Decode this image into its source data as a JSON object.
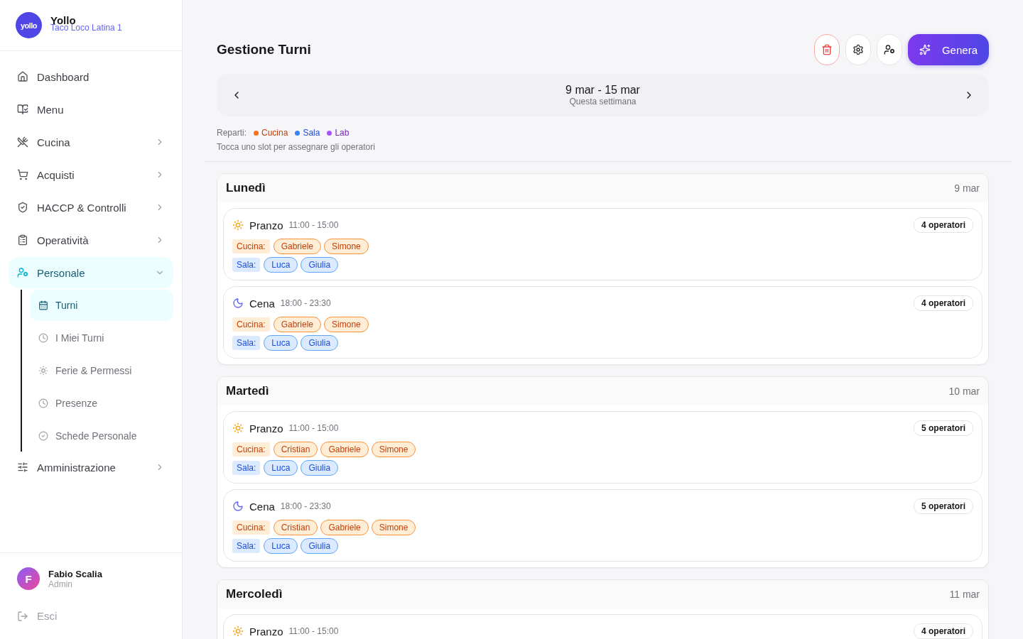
{
  "brand": {
    "logo": "yollo",
    "name": "Yollo",
    "location": "Taco Loco Latina 1"
  },
  "nav": [
    {
      "label": "Dashboard",
      "selected": false
    },
    {
      "label": "Menu",
      "selected": false
    },
    {
      "label": "Cucina",
      "selected": false,
      "expanded": false
    },
    {
      "label": "Acquisti",
      "selected": false,
      "expanded": false
    },
    {
      "label": "HACCP & Controlli",
      "selected": false,
      "expanded": false
    },
    {
      "label": "Operatività",
      "selected": false,
      "expanded": false
    },
    {
      "label": "Personale",
      "selected": true,
      "expanded": true,
      "children": [
        {
          "label": "Turni",
          "selected": true
        },
        {
          "label": "I Miei Turni",
          "selected": false
        },
        {
          "label": "Ferie & Permessi",
          "selected": false
        },
        {
          "label": "Presenze",
          "selected": false
        },
        {
          "label": "Schede Personale",
          "selected": false
        }
      ]
    },
    {
      "label": "Amministrazione",
      "selected": false,
      "expanded": false
    }
  ],
  "user": {
    "initial": "F",
    "name": "Fabio Scalia",
    "role": "Admin"
  },
  "logout": "Esci",
  "page_title": "Gestione Turni",
  "generate_button": "Genera",
  "week": {
    "range": "9 mar - 15 mar",
    "caption": "Questa settimana"
  },
  "legend": {
    "label": "Reparti:",
    "items": [
      {
        "name": "Cucina",
        "color": "#f97316"
      },
      {
        "name": "Sala",
        "color": "#3b82f6"
      },
      {
        "name": "Lab",
        "color": "#a855f7"
      }
    ]
  },
  "hint": "Tocca uno slot per assegnare gli operatori",
  "days": [
    {
      "name": "Lunedì",
      "date": "9 mar",
      "shifts": [
        {
          "kind": "lunch",
          "name": "Pranzo",
          "time": "11:00 - 15:00",
          "count": "4 operatori",
          "groups": [
            {
              "kind": "cucina",
              "label": "Cucina:",
              "people": [
                "Gabriele",
                "Simone"
              ]
            },
            {
              "kind": "sala",
              "label": "Sala:",
              "people": [
                "Luca",
                "Giulia"
              ]
            }
          ]
        },
        {
          "kind": "dinner",
          "name": "Cena",
          "time": "18:00 - 23:30",
          "count": "4 operatori",
          "groups": [
            {
              "kind": "cucina",
              "label": "Cucina:",
              "people": [
                "Gabriele",
                "Simone"
              ]
            },
            {
              "kind": "sala",
              "label": "Sala:",
              "people": [
                "Luca",
                "Giulia"
              ]
            }
          ]
        }
      ]
    },
    {
      "name": "Martedì",
      "date": "10 mar",
      "shifts": [
        {
          "kind": "lunch",
          "name": "Pranzo",
          "time": "11:00 - 15:00",
          "count": "5 operatori",
          "groups": [
            {
              "kind": "cucina",
              "label": "Cucina:",
              "people": [
                "Cristian",
                "Gabriele",
                "Simone"
              ]
            },
            {
              "kind": "sala",
              "label": "Sala:",
              "people": [
                "Luca",
                "Giulia"
              ]
            }
          ]
        },
        {
          "kind": "dinner",
          "name": "Cena",
          "time": "18:00 - 23:30",
          "count": "5 operatori",
          "groups": [
            {
              "kind": "cucina",
              "label": "Cucina:",
              "people": [
                "Cristian",
                "Gabriele",
                "Simone"
              ]
            },
            {
              "kind": "sala",
              "label": "Sala:",
              "people": [
                "Luca",
                "Giulia"
              ]
            }
          ]
        }
      ]
    },
    {
      "name": "Mercoledì",
      "date": "11 mar",
      "shifts": [
        {
          "kind": "lunch",
          "name": "Pranzo",
          "time": "11:00 - 15:00",
          "count": "4 operatori"
        }
      ]
    }
  ]
}
